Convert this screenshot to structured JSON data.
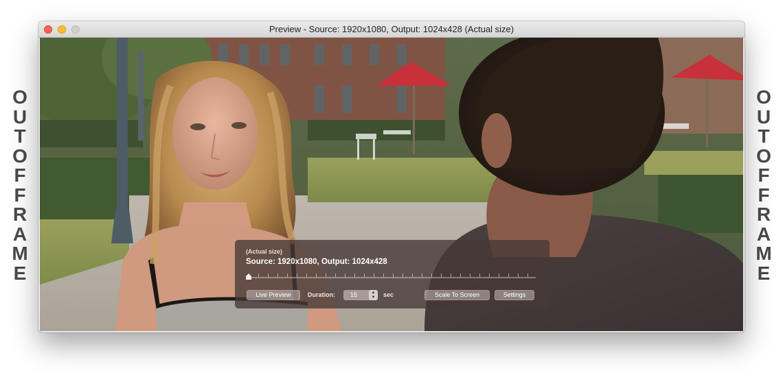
{
  "caption": {
    "left_lines": [
      "O",
      "U",
      "T",
      "",
      "O",
      "F",
      "",
      "F",
      "R",
      "A",
      "M",
      "E"
    ],
    "right_lines": [
      "O",
      "U",
      "T",
      "",
      "O",
      "F",
      "",
      "F",
      "R",
      "A",
      "M",
      "E"
    ]
  },
  "window": {
    "title": "Preview - Source: 1920x1080, Output: 1024x428 (Actual size)"
  },
  "hud": {
    "subtitle": "(Actual size)",
    "title": "Source: 1920x1080, Output: 1024x428",
    "scrubber_position": 0,
    "live_preview_label": "Live Preview",
    "duration_label": "Duration:",
    "duration_value": "15",
    "sec_label": "sec",
    "scale_to_screen_label": "Scale To Screen",
    "settings_label": "Settings"
  },
  "colors": {
    "close": "#fc5f57",
    "minimize": "#fdbc2e",
    "zoom": "#d0d0d0",
    "hud_background": "#463836",
    "caption_text": "#4a4a4a"
  },
  "icons": {
    "stepper": "stepper-arrows-icon",
    "scrubber_knob": "playhead-icon"
  }
}
